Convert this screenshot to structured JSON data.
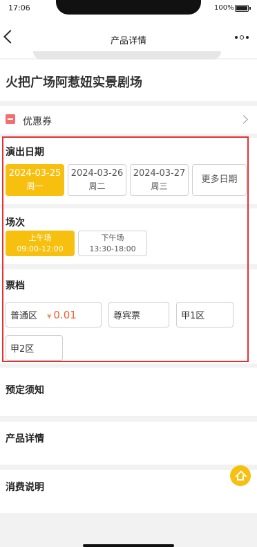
{
  "status_bar": {
    "time": "17:06",
    "battery_percent": "100%"
  },
  "nav": {
    "title": "产品详情"
  },
  "product": {
    "title": "火把广场阿惹妞实景剧场"
  },
  "coupon": {
    "label": "优惠券"
  },
  "show_date": {
    "title": "演出日期",
    "options": [
      {
        "date": "2024-03-25",
        "weekday": "周一",
        "selected": true
      },
      {
        "date": "2024-03-26",
        "weekday": "周二",
        "selected": false
      },
      {
        "date": "2024-03-27",
        "weekday": "周三",
        "selected": false
      }
    ],
    "more_label": "更多日期"
  },
  "session": {
    "title": "场次",
    "options": [
      {
        "name": "上午场",
        "time": "09:00-12:00",
        "selected": true
      },
      {
        "name": "下午场",
        "time": "13:30-18:00",
        "selected": false
      }
    ]
  },
  "ticket": {
    "title": "票档",
    "options": [
      {
        "name": "普通区",
        "currency": "¥",
        "price": "0.01"
      },
      {
        "name": "尊宾票"
      },
      {
        "name": "甲1区"
      },
      {
        "name": "甲2区"
      }
    ]
  },
  "sections": {
    "booking_notice": "预定须知",
    "product_details": "产品详情",
    "consumption_notes": "消费说明"
  },
  "colors": {
    "accent": "#f7c00f",
    "price": "#f06030",
    "highlight_border": "#e53030"
  }
}
